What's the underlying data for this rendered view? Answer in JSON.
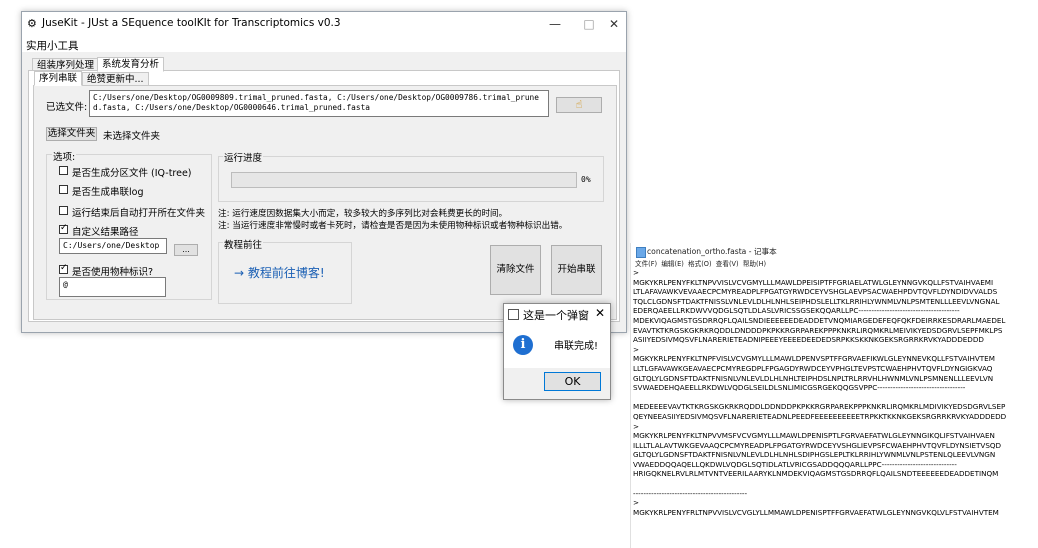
{
  "main_window": {
    "title": "JuseKit - JUst a SEquence toolKIt for Transcriptomics v0.3",
    "minimize_glyph": "—",
    "maximize_glyph": "□",
    "close_glyph": "✕",
    "menu": "实用小工具",
    "tabs": [
      "组装序列处理",
      "系统发育分析"
    ],
    "subtabs": [
      "序列串联",
      "绝赞更新中..."
    ],
    "selected_files_label": "已选文件:",
    "selected_files": "C:/Users/one/Desktop/OG0009809.trimal_pruned.fasta, C:/Users/one/Desktop/OG0009786.trimal_pruned.fasta, C:/Users/one/Desktop/OG0000646.trimal_pruned.fasta",
    "select_folder_button": "选择文件夹",
    "folder_status": "未选择文件夹",
    "options": {
      "legend": "选项:",
      "opt1": "是否生成分区文件 (IQ-tree)",
      "opt2": "是否生成串联log",
      "opt3": "运行结束后自动打开所在文件夹",
      "opt4": "自定义结果路径",
      "path_value": "C:/Users/one/Desktop",
      "browse_label": "...",
      "opt5": "是否使用物种标识?",
      "species_value": "@"
    },
    "progress": {
      "legend": "运行进度",
      "value": 0,
      "text": "0%"
    },
    "notes": [
      "注: 运行速度因数据集大小而定，较多较大的多序列比对会耗费更长的时间。",
      "注: 当运行速度非常慢时或者卡死时，请检查是否是因为未使用物种标识或者物种标识出错。"
    ],
    "blog": {
      "legend": "教程前往",
      "link": "→ 教程前往博客!"
    },
    "clear_button": "清除文件",
    "start_button": "开始串联"
  },
  "dialog": {
    "title": "这是一个弹窗",
    "close_glyph": "✕",
    "message": "串联完成!",
    "ok_label": "OK"
  },
  "notepad": {
    "title": "concatenation_ortho.fasta - 记事本",
    "menu": [
      "文件(F)",
      "编辑(E)",
      "格式(O)",
      "查看(V)",
      "帮助(H)"
    ],
    "content": ">\nMGKYKRLPENYFKLTNPVVISLVCVGMYLLLMAWLDPEISIPTFFGRIAELATWLGLEYNNGVKQLLFSTVAIHVAEMI\nLTLAFAVAWKVEVAAECPCMYREADPLFPGATGYRWDCEYVSHGLAEVPSACWAEHPDVTQVFLDYNDIDVVALDS\nTQLCLGDNSFTDAKTFNISSLVNLEVLDLHLNHLSEIPHDSLELLTKLRRIHLYWNMLVNLPSMTENLLLEEVLVNGNAL\nEDERQAEELLRKDWVVQDGLSQTLDLASLVRICSSGSEKQQARLLPC---------------------------------------\nMDEKVIQAGMSTGSDRRQFLQAILSNDIEEEEEEDEADDETVNQMIARGEDEFEQFQKFDEIRRKESDRARLMAEDEL\nEVAVTKTKRGSKGKRKRQDDLDNDDDPKPKKRGRPAREKPPPKNKRLIRQMKRLMEIVIKYEDSDGRVLSEPFMKLPS\nASIIYEDSIVMQSVFLNARERIETEADNIPEEEYEEEEDEEDEDSRPKKSKKNKGEKSRGRRKRVKYADDDEDDD\n>\nMGKYKRLPENYFKLTNPFVISLVCVGMYLLLMAWLDPENVSPTFFGRVAEFIKWLGLEYNNEVKQLLFSTVAIHVTEM\nLLTLGFAVAWKGEAVAECPCMYREGDPLFPGAGDYRWDCEYVPHGLTEVPSTCWAEHPHVTQVFLDYNGIGKVAQ\nGLTQLYLGDNSFTDAKTFNISNLVNLEVLDLHLNHLTEIPHDSLNPLTRLRRVHLHWNMLVNLPSMNENLLLEEVLVN\nSVWAEDEHQAEELLRKDWLVQDGLSEILDLSNLIMICGSRGEKQQGSVPPC----------------------------------\n\nMEDEEEEVAVTKTKRGSKGKRKRQDDLDDNDDPKPKKRGRPAREKPPPKNKRLIRQMKRLMDIVIKYEDSDGRVLSEP\nQEYNEEASIIYEDSIVMQSVFLNARERIETEADNLPEEDFEEEEEEEEEETRPKKTKKNKGEKSRGRRKRVKYADDDEDD\n>\nMGKYKRLPENYFKLTNPVVMSFVCVGMYLLLMAWLDPENISPTLFGRVAEFATWLGLEYNNGIKQLIFSTVAIHVAEN\nILLLTLALAVTWKGEVAAQCPCMYREADPLFPGATGYRWDCEYVSHGLIEVPSFCWAEHPHVTQVFLDYNSIETVSQD\nGLTQLYLGDNSFTDAKTFNISNLVNLEVLDLHLNHLSDIPHGSLEPLTKLRRIHLYWNMLVNLPSTENLQLEEVLVNGN\nVWAEDDQQAQELLQKDWLVQDGLSQTIDLATLVRICGSADDQQQARLLPPC-----------------------------\nHRIGQKNELRVLRLMTVNTVEERILAARYKLNMDEKVIQAGMSTGSDRRQFLQAILSNDTEEEEEEDEADDETINQM\n\n--------------------------------------------\n>\nMGKYKRLPENYFRLTNPVVISLVCVGLYLLMMAWLDPENISPTFFGRVAEFATWLGLEYNNGVKQLVLFSTVAIHVTEM"
  }
}
